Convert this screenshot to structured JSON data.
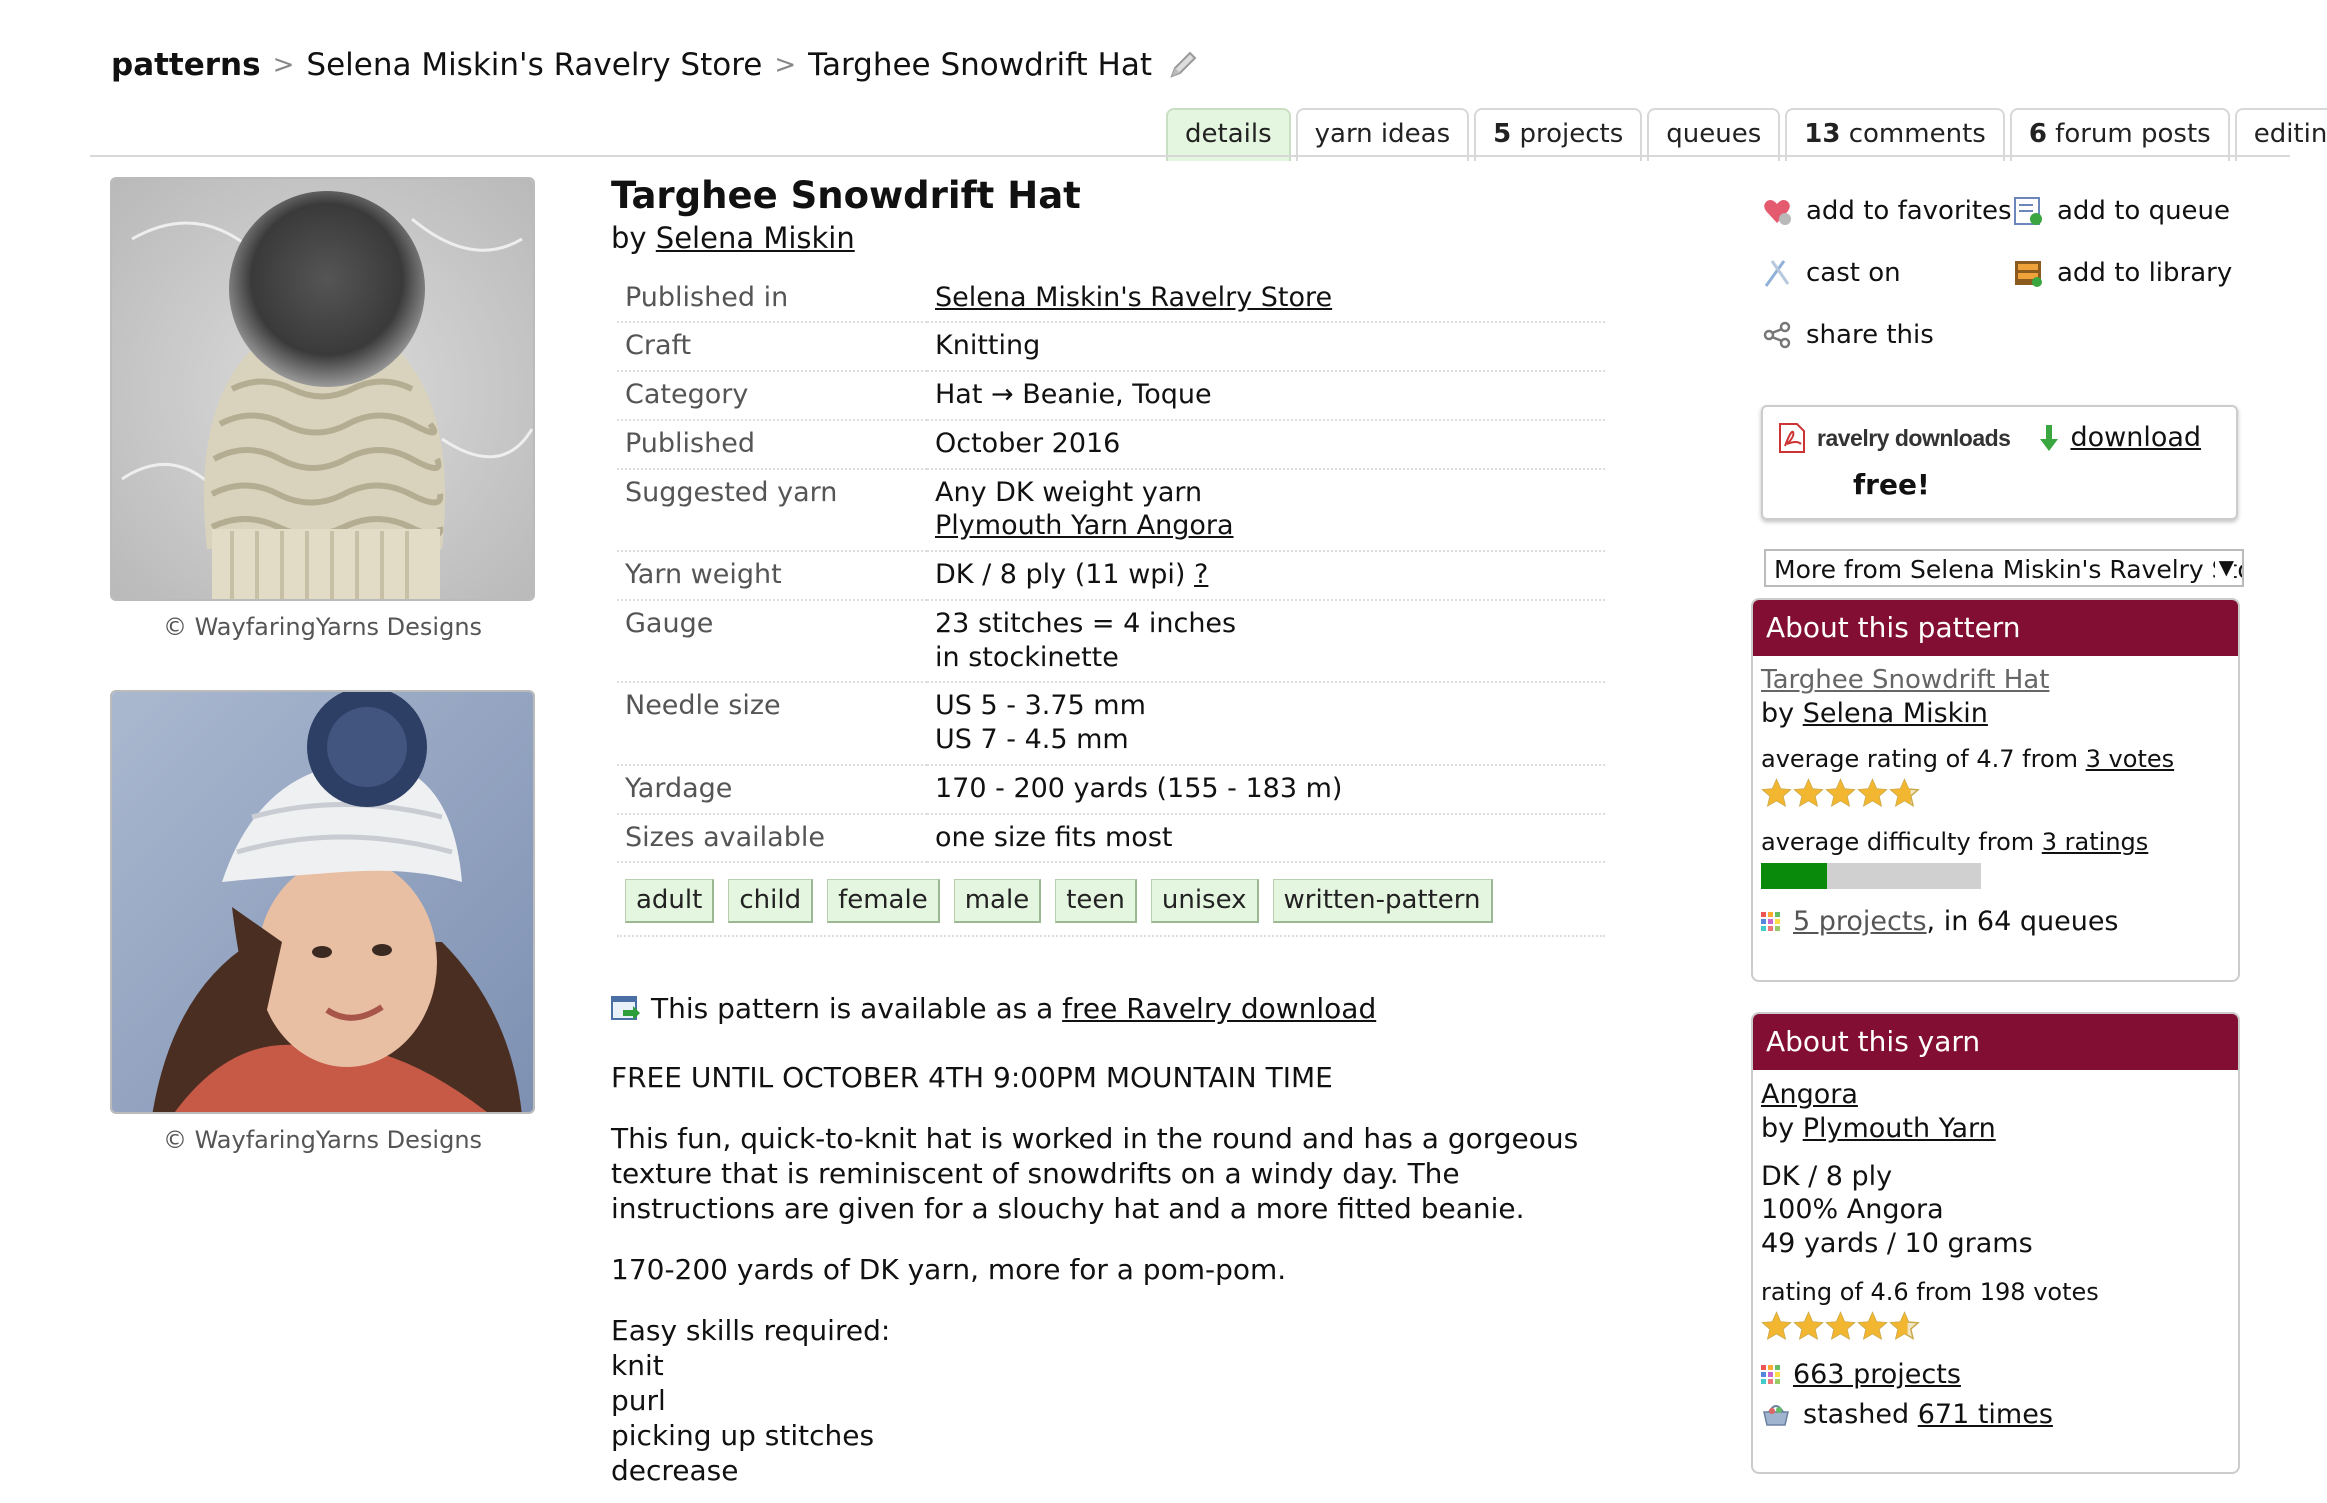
{
  "breadcrumb": {
    "root": "patterns",
    "store": "Selena Miskin's Ravelry Store",
    "current": "Targhee Snowdrift Hat",
    "edit_icon": "pencil-icon"
  },
  "tabs": [
    {
      "count": "",
      "label": "details"
    },
    {
      "count": "",
      "label": "yarn ideas"
    },
    {
      "count": "5",
      "label": " projects"
    },
    {
      "count": "",
      "label": "queues"
    },
    {
      "count": "13",
      "label": " comments"
    },
    {
      "count": "6",
      "label": " forum posts"
    },
    {
      "count": "",
      "label": "editing"
    }
  ],
  "photos": {
    "caption1": "© WayfaringYarns Designs",
    "caption2": "© WayfaringYarns Designs"
  },
  "pattern": {
    "title": "Targhee Snowdrift Hat",
    "by": "by",
    "designer": "Selena Miskin"
  },
  "info": {
    "published_in_label": "Published in",
    "published_in_value": "Selena Miskin's Ravelry Store",
    "craft_label": "Craft",
    "craft_value": "Knitting",
    "category_label": "Category",
    "category_value": "Hat → Beanie, Toque",
    "published_label": "Published",
    "published_value": "October 2016",
    "yarn_label": "Suggested yarn",
    "yarn_value1": "Any DK weight yarn",
    "yarn_value2": "Plymouth Yarn Angora",
    "weight_label": "Yarn weight",
    "weight_value": "DK / 8 ply (11 wpi)",
    "weight_help": "?",
    "gauge_label": "Gauge",
    "gauge_value1": "23 stitches = 4 inches",
    "gauge_value2": "in stockinette",
    "needle_label": "Needle size",
    "needle_value1": "US 5 - 3.75 mm",
    "needle_value2": "US 7 - 4.5 mm",
    "yardage_label": "Yardage",
    "yardage_value": "170 - 200 yards (155 - 183 m)",
    "sizes_label": "Sizes available",
    "sizes_value": "one size fits most"
  },
  "tags": [
    "adult",
    "child",
    "female",
    "male",
    "teen",
    "unisex",
    "written-pattern"
  ],
  "availability": {
    "prefix": "This pattern is available as a ",
    "link": "free Ravelry download"
  },
  "description": {
    "p1": "FREE UNTIL OCTOBER 4TH 9:00PM MOUNTAIN TIME",
    "p2": "This fun, quick-to-knit hat is worked in the round and has a gorgeous texture that is reminiscent of snowdrifts on a windy day. The instructions are given for a slouchy hat and a more fitted beanie.",
    "p3": "170-200 yards of DK yarn, more for a pom-pom.",
    "skills_heading": "Easy skills required:",
    "skills": [
      "knit",
      "purl",
      "picking up stitches",
      "decrease"
    ]
  },
  "actions": {
    "favorites": "add to favorites",
    "queue": "add to queue",
    "cast_on": "cast on",
    "library": "add to library",
    "share": "share this"
  },
  "download": {
    "brand": "ravelry downloads",
    "link": "download",
    "price": "free!"
  },
  "more_select": {
    "selected": "More from Selena Miskin's Ravelry Store"
  },
  "about_pattern": {
    "heading": "About this pattern",
    "name": "Targhee Snowdrift Hat",
    "by": "by ",
    "designer": "Selena Miskin",
    "rating_prefix": "average rating of 4.7 from ",
    "rating_votes": "3 votes",
    "rating": 4.7,
    "difficulty_prefix": "average difficulty from ",
    "difficulty_ratings": "3 ratings",
    "difficulty_fraction": 0.3,
    "projects_link": "5 projects",
    "queues_suffix": ", in 64 queues"
  },
  "about_yarn": {
    "heading": "About this yarn",
    "name": "Angora",
    "by": "by ",
    "company": "Plymouth Yarn",
    "weight": "DK / 8 ply",
    "fiber": "100% Angora",
    "yardage": "49 yards / 10 grams",
    "rating_text": "rating of 4.6 from 198 votes",
    "rating": 4.6,
    "projects_link": "663 projects",
    "stashed_prefix": "stashed ",
    "stashed_link": "671 times"
  },
  "colors": {
    "accent": "#820e33",
    "tag_bg": "#e5f6e0",
    "difficulty_bar": "#0a8a0a"
  }
}
